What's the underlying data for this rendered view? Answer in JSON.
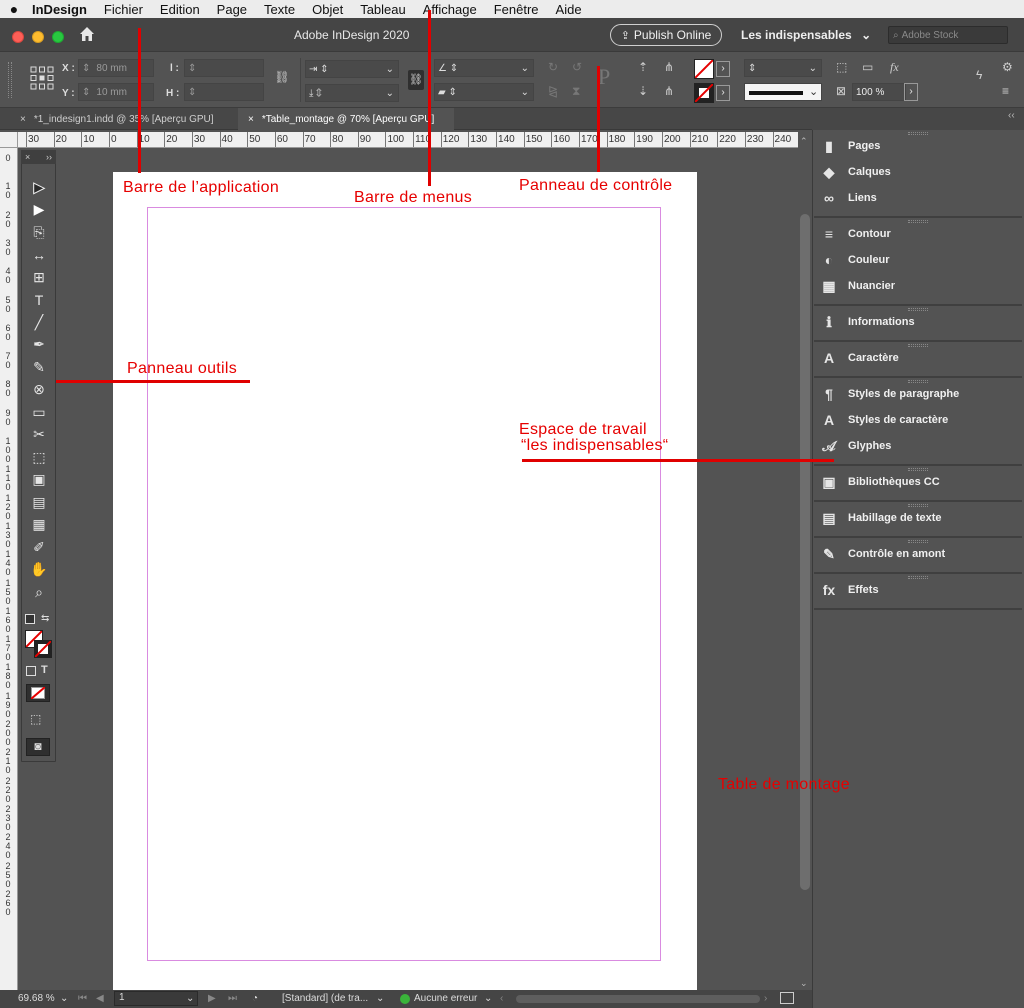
{
  "menubar": {
    "apple": "",
    "items": [
      "InDesign",
      "Fichier",
      "Edition",
      "Page",
      "Texte",
      "Objet",
      "Tableau",
      "Affichage",
      "Fenêtre",
      "Aide"
    ]
  },
  "appbar": {
    "title": "Adobe InDesign 2020",
    "publish_label": "Publish Online",
    "workspace": "Les indispensables",
    "stock_placeholder": "Adobe Stock"
  },
  "control": {
    "x_label": "X :",
    "x_value": "80 mm",
    "y_label": "Y :",
    "y_value": "10 mm",
    "w_label": "l :",
    "h_label": "H :",
    "zoom_value": "100 %"
  },
  "tabs": [
    {
      "label": "*1_indesign1.indd @ 35% [Aperçu GPU]",
      "close": "×"
    },
    {
      "label": "*Table_montage @ 70% [Aperçu GPU]",
      "close": "×"
    }
  ],
  "ruler_h": [
    "30",
    "20",
    "10",
    "0",
    "10",
    "20",
    "30",
    "40",
    "50",
    "60",
    "70",
    "80",
    "90",
    "100",
    "110",
    "120",
    "130",
    "140",
    "150",
    "160",
    "170",
    "180",
    "190",
    "200",
    "210",
    "220",
    "230",
    "240"
  ],
  "ruler_v": [
    "0",
    "1 0",
    "2 0",
    "3 0",
    "4 0",
    "5 0",
    "6 0",
    "7 0",
    "8 0",
    "9 0",
    "1 0 0",
    "1 1 0",
    "1 2 0",
    "1 3 0",
    "1 4 0",
    "1 5 0",
    "1 6 0",
    "1 7 0",
    "1 8 0",
    "1 9 0",
    "2 0 0",
    "2 1 0",
    "2 2 0",
    "2 3 0",
    "2 4 0",
    "2 5 0",
    "2 6 0"
  ],
  "tools_header": {
    "close": "×",
    "expand": "››"
  },
  "tools": [
    {
      "name": "selection-tool",
      "glyph": "▶"
    },
    {
      "name": "direct-selection-tool",
      "glyph": "▶"
    },
    {
      "name": "page-tool",
      "glyph": "⎘"
    },
    {
      "name": "gap-tool",
      "glyph": "↔"
    },
    {
      "name": "content-collector-tool",
      "glyph": "⊞"
    },
    {
      "name": "type-tool",
      "glyph": "T"
    },
    {
      "name": "line-tool",
      "glyph": "╱"
    },
    {
      "name": "pen-tool",
      "glyph": "✒"
    },
    {
      "name": "pencil-tool",
      "glyph": "✎"
    },
    {
      "name": "rectangle-frame-tool",
      "glyph": "⊗"
    },
    {
      "name": "rectangle-tool",
      "glyph": "▭"
    },
    {
      "name": "scissors-tool",
      "glyph": "✂"
    },
    {
      "name": "free-transform-tool",
      "glyph": "⬚"
    },
    {
      "name": "gradient-swatch-tool",
      "glyph": "▣"
    },
    {
      "name": "gradient-feather-tool",
      "glyph": "▤"
    },
    {
      "name": "note-tool",
      "glyph": "▦"
    },
    {
      "name": "eyedropper-tool",
      "glyph": "✐"
    },
    {
      "name": "hand-tool",
      "glyph": "✋"
    },
    {
      "name": "zoom-tool",
      "glyph": "⌕"
    }
  ],
  "panels": [
    {
      "group": 1,
      "items": [
        {
          "label": "Pages",
          "icon": "pages-icon",
          "glyph": "▮"
        },
        {
          "label": "Calques",
          "icon": "layers-icon",
          "glyph": "◆"
        },
        {
          "label": "Liens",
          "icon": "links-icon",
          "glyph": "∞"
        }
      ]
    },
    {
      "group": 2,
      "items": [
        {
          "label": "Contour",
          "icon": "stroke-icon",
          "glyph": "≡"
        },
        {
          "label": "Couleur",
          "icon": "color-icon",
          "glyph": "◐"
        },
        {
          "label": "Nuancier",
          "icon": "swatches-icon",
          "glyph": "▦"
        }
      ]
    },
    {
      "group": 3,
      "items": [
        {
          "label": "Informations",
          "icon": "info-icon",
          "glyph": "ℹ"
        }
      ]
    },
    {
      "group": 4,
      "items": [
        {
          "label": "Caractère",
          "icon": "character-icon",
          "glyph": "A"
        }
      ]
    },
    {
      "group": 5,
      "items": [
        {
          "label": "Styles de paragraphe",
          "icon": "paragraph-styles-icon",
          "glyph": "¶"
        },
        {
          "label": "Styles de caractère",
          "icon": "character-styles-icon",
          "glyph": "A"
        },
        {
          "label": "Glyphes",
          "icon": "glyphs-icon",
          "glyph": "𝒜"
        }
      ]
    },
    {
      "group": 6,
      "items": [
        {
          "label": "Bibliothèques CC",
          "icon": "cc-libraries-icon",
          "glyph": "▣"
        }
      ]
    },
    {
      "group": 7,
      "items": [
        {
          "label": "Habillage de texte",
          "icon": "text-wrap-icon",
          "glyph": "▤"
        }
      ]
    },
    {
      "group": 8,
      "items": [
        {
          "label": "Contrôle en amont",
          "icon": "preflight-icon",
          "glyph": "✎"
        }
      ]
    },
    {
      "group": 9,
      "items": [
        {
          "label": "Effets",
          "icon": "effects-icon",
          "glyph": "fx"
        }
      ]
    }
  ],
  "status": {
    "zoom": "69.68 %",
    "page": "1",
    "style": "[Standard] (de tra...",
    "errors": "Aucune erreur"
  },
  "annotations": {
    "app_bar": "Barre de l’application",
    "menu_bar": "Barre de menus",
    "control_panel": "Panneau de contrôle",
    "tools_panel": "Panneau outils",
    "workspace_line1": "Espace de travail",
    "workspace_line2": "“les indispensables“",
    "pasteboard": "Table de montage"
  },
  "colors": {
    "annotation": "#e60000",
    "margin_guide": "#d98be0",
    "ui_bg": "#535353"
  }
}
